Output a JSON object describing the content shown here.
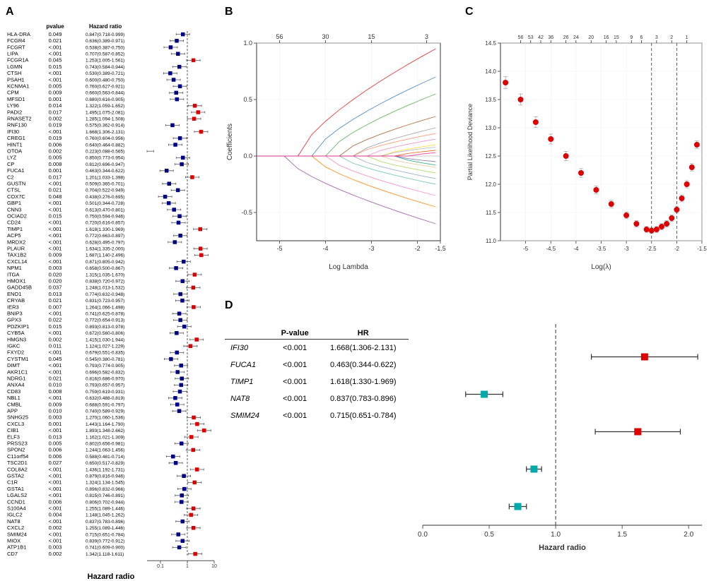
{
  "panels": {
    "a": {
      "label": "A",
      "axis_label": "Hazard radio",
      "header_gene": "",
      "header_pvalue": "pvalue",
      "header_hr": "Hazard ratio",
      "rows": [
        {
          "gene": "HLA-DRA",
          "pvalue": "0.049",
          "hr": "0.847(0.718-0.999)",
          "dir": "neg",
          "log_hr": -0.165
        },
        {
          "gene": "FCGR4",
          "pvalue": "0.021",
          "hr": "0.636(0.389-0.971)",
          "dir": "neg",
          "log_hr": -0.394
        },
        {
          "gene": "FCGRT",
          "pvalue": "<.001",
          "hr": "0.538(0.387-0.750)",
          "dir": "neg",
          "log_hr": -0.619
        },
        {
          "gene": "LIPA",
          "pvalue": "<.001",
          "hr": "0.707(0.587-0.852)",
          "dir": "neg",
          "log_hr": -0.347
        },
        {
          "gene": "FCGR1A",
          "pvalue": "0.045",
          "hr": "1.253(1.005-1.561)",
          "dir": "pos",
          "log_hr": 0.226
        },
        {
          "gene": "LGMN",
          "pvalue": "0.015",
          "hr": "0.743(0.584-0.944)",
          "dir": "neg",
          "log_hr": -0.297
        },
        {
          "gene": "CTSH",
          "pvalue": "<.001",
          "hr": "0.530(0.389-0.721)",
          "dir": "neg",
          "log_hr": -0.635
        },
        {
          "gene": "PSAH1",
          "pvalue": "<.001",
          "hr": "0.600(0.480-0.750)",
          "dir": "neg",
          "log_hr": -0.511
        },
        {
          "gene": "KCNMA1",
          "pvalue": "0.005",
          "hr": "0.760(0.627-0.921)",
          "dir": "neg",
          "log_hr": -0.274
        },
        {
          "gene": "CPM",
          "pvalue": "0.009",
          "hr": "0.660(0.563-0.844)",
          "dir": "neg",
          "log_hr": -0.415
        },
        {
          "gene": "MFSD1",
          "pvalue": "0.001",
          "hr": "0.680(0.616-0.905)",
          "dir": "neg",
          "log_hr": -0.386
        },
        {
          "gene": "LY96",
          "pvalue": "0.014",
          "hr": "1.322(1.059-1.652)",
          "dir": "pos",
          "log_hr": 0.279
        },
        {
          "gene": "PADI2",
          "pvalue": "0.017",
          "hr": "1.495(1.075-2.081)",
          "dir": "pos",
          "log_hr": 0.402
        },
        {
          "gene": "RNASET2",
          "pvalue": "0.002",
          "hr": "1.285(1.094-1.508)",
          "dir": "pos",
          "log_hr": 0.251
        },
        {
          "gene": "RNF130",
          "pvalue": "0.019",
          "hr": "0.575(0.362-0.914)",
          "dir": "neg",
          "log_hr": -0.553
        },
        {
          "gene": "IFI30",
          "pvalue": "<.001",
          "hr": "1.668(1.306-2.131)",
          "dir": "pos",
          "log_hr": 0.512
        },
        {
          "gene": "CREG1",
          "pvalue": "0.019",
          "hr": "0.760(0.604-0.956)",
          "dir": "neg",
          "log_hr": -0.274
        },
        {
          "gene": "HINT1",
          "pvalue": "0.006",
          "hr": "0.640(0.464-0.882)",
          "dir": "neg",
          "log_hr": -0.446
        },
        {
          "gene": "OTOA",
          "pvalue": "0.002",
          "hr": "0.223(0.088-0.565)",
          "dir": "neg",
          "log_hr": -1.502
        },
        {
          "gene": "LYZ",
          "pvalue": "0.005",
          "hr": "0.850(0.773-0.954)",
          "dir": "neg",
          "log_hr": -0.163
        },
        {
          "gene": "CP",
          "pvalue": "0.008",
          "hr": "0.812(0.696-0.947)",
          "dir": "neg",
          "log_hr": -0.208
        },
        {
          "gene": "FUCA1",
          "pvalue": "0.001",
          "hr": "0.463(0.344-0.622)",
          "dir": "neg",
          "log_hr": -0.77
        },
        {
          "gene": "C2",
          "pvalue": "0.017",
          "hr": "1.201(1.033-1.398)",
          "dir": "pos",
          "log_hr": 0.183
        },
        {
          "gene": "GUSTN",
          "pvalue": "<.001",
          "hr": "0.509(0.365-0.701)",
          "dir": "neg",
          "log_hr": -0.677
        },
        {
          "gene": "CTSL",
          "pvalue": "0.021",
          "hr": "0.704(0.522-0.949)",
          "dir": "neg",
          "log_hr": -0.351
        },
        {
          "gene": "COX7C",
          "pvalue": "0.048",
          "hr": "0.438(0.276-0.695)",
          "dir": "neg",
          "log_hr": -0.826
        },
        {
          "gene": "GBP1",
          "pvalue": "<.001",
          "hr": "0.501(0.344-0.728)",
          "dir": "neg",
          "log_hr": -0.691
        },
        {
          "gene": "CNN3",
          "pvalue": "<.001",
          "hr": "0.613(0.470-0.801)",
          "dir": "neg",
          "log_hr": -0.494
        },
        {
          "gene": "OCIAD2",
          "pvalue": "0.015",
          "hr": "0.750(0.594-0.946)",
          "dir": "neg",
          "log_hr": -0.288
        },
        {
          "gene": "CD24",
          "pvalue": "<.001",
          "hr": "0.720(0.616-0.857)",
          "dir": "neg",
          "log_hr": -0.329
        },
        {
          "gene": "TIMP1",
          "pvalue": "<.001",
          "hr": "1.618(1.330-1.969)",
          "dir": "pos",
          "log_hr": 0.481
        },
        {
          "gene": "ACP5",
          "pvalue": "<.001",
          "hr": "0.772(0.663-0.897)",
          "dir": "neg",
          "log_hr": -0.259
        },
        {
          "gene": "MRDX2",
          "pvalue": "<.001",
          "hr": "0.628(0.495-0.797)",
          "dir": "neg",
          "log_hr": -0.465
        },
        {
          "gene": "PLAUR",
          "pvalue": "<.001",
          "hr": "1.634(1.335-2.000)",
          "dir": "pos",
          "log_hr": 0.491
        },
        {
          "gene": "TAX1B2",
          "pvalue": "0.009",
          "hr": "1.687(1.140-2.496)",
          "dir": "pos",
          "log_hr": 0.522
        },
        {
          "gene": "CXCL14",
          "pvalue": "<.001",
          "hr": "0.871(0.805-0.942)",
          "dir": "neg",
          "log_hr": -0.138
        },
        {
          "gene": "NPM1",
          "pvalue": "0.003",
          "hr": "0.658(0.500-0.867)",
          "dir": "neg",
          "log_hr": -0.419
        },
        {
          "gene": "ITGA",
          "pvalue": "0.020",
          "hr": "1.315(1.035-1.670)",
          "dir": "pos",
          "log_hr": 0.274
        },
        {
          "gene": "HMOX1",
          "pvalue": "0.020",
          "hr": "0.838(0.720-0.972)",
          "dir": "neg",
          "log_hr": -0.177
        },
        {
          "gene": "GADD45B",
          "pvalue": "0.037",
          "hr": "1.248(1.013-1.532)",
          "dir": "pos",
          "log_hr": 0.222
        },
        {
          "gene": "ENO1",
          "pvalue": "0.013",
          "hr": "0.774(0.632-0.948)",
          "dir": "neg",
          "log_hr": -0.256
        },
        {
          "gene": "CRYAB",
          "pvalue": "0.021",
          "hr": "0.831(0.723-0.957)",
          "dir": "neg",
          "log_hr": -0.185
        },
        {
          "gene": "IER3",
          "pvalue": "0.007",
          "hr": "1.264(1.066-1.498)",
          "dir": "pos",
          "log_hr": 0.235
        },
        {
          "gene": "BNIP3",
          "pvalue": "<.001",
          "hr": "0.741(0.625-0.878)",
          "dir": "neg",
          "log_hr": -0.3
        },
        {
          "gene": "GPX3",
          "pvalue": "0.022",
          "hr": "0.772(0.654-0.913)",
          "dir": "neg",
          "log_hr": -0.259
        },
        {
          "gene": "PDZKIP1",
          "pvalue": "0.015",
          "hr": "0.893(0.813-0.978)",
          "dir": "neg",
          "log_hr": -0.113
        },
        {
          "gene": "CYB5A",
          "pvalue": "<.001",
          "hr": "0.672(0.560-0.806)",
          "dir": "neg",
          "log_hr": -0.398
        },
        {
          "gene": "HMGN3",
          "pvalue": "0.002",
          "hr": "1.415(1.030-1.944)",
          "dir": "pos",
          "log_hr": 0.347
        },
        {
          "gene": "IGKC",
          "pvalue": "0.011",
          "hr": "1.124(1.027-1.229)",
          "dir": "pos",
          "log_hr": 0.117
        },
        {
          "gene": "FXYD2",
          "pvalue": "<.001",
          "hr": "0.679(0.551-0.835)",
          "dir": "neg",
          "log_hr": -0.387
        },
        {
          "gene": "CYSTM1",
          "pvalue": "0.045",
          "hr": "0.545(0.380-0.781)",
          "dir": "neg",
          "log_hr": -0.607
        },
        {
          "gene": "DIMT",
          "pvalue": "<.001",
          "hr": "0.793(0.774-0.905)",
          "dir": "neg",
          "log_hr": -0.231
        },
        {
          "gene": "AKR1C1",
          "pvalue": "<.001",
          "hr": "0.696(0.582-0.832)",
          "dir": "neg",
          "log_hr": -0.362
        },
        {
          "gene": "NDRG1",
          "pvalue": "0.021",
          "hr": "0.816(0.686-0.970)",
          "dir": "neg",
          "log_hr": -0.203
        },
        {
          "gene": "ANXA4",
          "pvalue": "0.010",
          "hr": "0.793(0.657-0.957)",
          "dir": "neg",
          "log_hr": -0.231
        },
        {
          "gene": "CD83",
          "pvalue": "0.008",
          "hr": "0.759(0.619-0.931)",
          "dir": "neg",
          "log_hr": -0.276
        },
        {
          "gene": "NBL1",
          "pvalue": "<.001",
          "hr": "0.632(0.488-0.819)",
          "dir": "neg",
          "log_hr": -0.449
        },
        {
          "gene": "CMBL",
          "pvalue": "0.009",
          "hr": "0.688(0.591-0.797)",
          "dir": "neg",
          "log_hr": -0.374
        },
        {
          "gene": "APP",
          "pvalue": "0.010",
          "hr": "0.740(0.589-0.929)",
          "dir": "neg",
          "log_hr": -0.301
        },
        {
          "gene": "SNHG25",
          "pvalue": "0.003",
          "hr": "1.270(1.060-1.536)",
          "dir": "pos",
          "log_hr": 0.239
        },
        {
          "gene": "CXCL3",
          "pvalue": "0.001",
          "hr": "1.443(1.164-1.790)",
          "dir": "pos",
          "log_hr": 0.367
        },
        {
          "gene": "CIB1",
          "pvalue": "<.001",
          "hr": "1.893(1.348-2.662)",
          "dir": "pos",
          "log_hr": 0.627
        },
        {
          "gene": "ELF3",
          "pvalue": "0.013",
          "hr": "1.162(1.021-1.309)",
          "dir": "pos",
          "log_hr": 0.15
        },
        {
          "gene": "PRSS23",
          "pvalue": "0.005",
          "hr": "0.802(0.656-0.981)",
          "dir": "neg",
          "log_hr": -0.216
        },
        {
          "gene": "SPON2",
          "pvalue": "0.006",
          "hr": "1.244(1.063-1.456)",
          "dir": "pos",
          "log_hr": 0.219
        },
        {
          "gene": "C11orf54",
          "pvalue": "0.006",
          "hr": "0.588(0.481-0.714)",
          "dir": "neg",
          "log_hr": -0.531
        },
        {
          "gene": "TSC2D1",
          "pvalue": "0.027",
          "hr": "0.650(0.517-0.829)",
          "dir": "neg",
          "log_hr": -0.431
        },
        {
          "gene": "COL8A2",
          "pvalue": "<.001",
          "hr": "1.436(1.192-1.731)",
          "dir": "pos",
          "log_hr": 0.362
        },
        {
          "gene": "GSTA2",
          "pvalue": "<.001",
          "hr": "0.879(0.816-0.946)",
          "dir": "neg",
          "log_hr": -0.129
        },
        {
          "gene": "C1R",
          "pvalue": "<.001",
          "hr": "1.324(1.134-1.545)",
          "dir": "pos",
          "log_hr": 0.271
        },
        {
          "gene": "GSTA1",
          "pvalue": "<.001",
          "hr": "0.896(0.832-0.966)",
          "dir": "neg",
          "log_hr": -0.11
        },
        {
          "gene": "LGALS2",
          "pvalue": "<.001",
          "hr": "0.815(0.746-0.891)",
          "dir": "neg",
          "log_hr": -0.204
        },
        {
          "gene": "CCND1",
          "pvalue": "0.006",
          "hr": "0.806(0.702-0.944)",
          "dir": "neg",
          "log_hr": -0.215
        },
        {
          "gene": "S100A4",
          "pvalue": "<.001",
          "hr": "1.255(1.089-1.446)",
          "dir": "pos",
          "log_hr": 0.227
        },
        {
          "gene": "IGLC2",
          "pvalue": "0.004",
          "hr": "1.148(1.045-1.262)",
          "dir": "pos",
          "log_hr": 0.138
        },
        {
          "gene": "NAT8",
          "pvalue": "<.001",
          "hr": "0.837(0.783-0.896)",
          "dir": "neg",
          "log_hr": -0.178
        },
        {
          "gene": "CXCL2",
          "pvalue": "0.002",
          "hr": "1.255(1.089-1.446)",
          "dir": "pos",
          "log_hr": 0.227
        },
        {
          "gene": "SMIM24",
          "pvalue": "<.001",
          "hr": "0.715(0.651-0.784)",
          "dir": "neg",
          "log_hr": -0.335
        },
        {
          "gene": "MIOX",
          "pvalue": "<.001",
          "hr": "0.839(0.772-0.912)",
          "dir": "neg",
          "log_hr": -0.176
        },
        {
          "gene": "ATP1B1",
          "pvalue": "0.003",
          "hr": "0.741(0.609-0.900)",
          "dir": "neg",
          "log_hr": -0.3
        },
        {
          "gene": "CD7",
          "pvalue": "0.002",
          "hr": "1.342(1.118-1.611)",
          "dir": "pos",
          "log_hr": 0.294
        }
      ]
    },
    "b": {
      "label": "B",
      "x_label": "Log Lambda",
      "y_label": "Coefficients",
      "x_ticks": [
        "-5",
        "-4",
        "-3",
        "-2",
        "-1.5"
      ],
      "top_ticks": [
        "56",
        "30",
        "15",
        "3"
      ],
      "y_range": [
        -0.75,
        1.0
      ]
    },
    "c": {
      "label": "C",
      "x_label": "Log(λ)",
      "y_label": "Partial Likelihood Deviance",
      "x_ticks": [
        "-5",
        "-4.5",
        "-4",
        "-3.5",
        "-3",
        "-2.5",
        "-2",
        "-1.5"
      ],
      "top_ticks": [
        "56",
        "53",
        "42",
        "36",
        "26",
        "24",
        "20",
        "16",
        "15",
        "9",
        "6",
        "3",
        "2",
        "1"
      ],
      "y_range": [
        11.0,
        14.5
      ]
    },
    "d": {
      "label": "D",
      "x_label": "Hazard radio",
      "columns": [
        "",
        "P-value",
        "HR"
      ],
      "rows": [
        {
          "gene": "IFI30",
          "pvalue": "<0.001",
          "hr": "1.668(1.306-2.131)",
          "log_hr": 0.512,
          "dir": "pos"
        },
        {
          "gene": "FUCA1",
          "pvalue": "<0.001",
          "hr": "0.463(0.344-0.622)",
          "log_hr": -0.77,
          "dir": "neg"
        },
        {
          "gene": "TIMP1",
          "pvalue": "<0.001",
          "hr": "1.618(1.330-1.969)",
          "log_hr": 0.481,
          "dir": "pos"
        },
        {
          "gene": "NAT8",
          "pvalue": "<0.001",
          "hr": "0.837(0.783-0.896)",
          "log_hr": -0.178,
          "dir": "neg"
        },
        {
          "gene": "SMIM24",
          "pvalue": "<0.001",
          "hr": "0.715(0.651-0.784)",
          "log_hr": -0.335,
          "dir": "neg"
        }
      ],
      "x_axis_ticks": [
        "0.0",
        "0.5",
        "1.0",
        "1.5",
        "2.0"
      ]
    }
  }
}
